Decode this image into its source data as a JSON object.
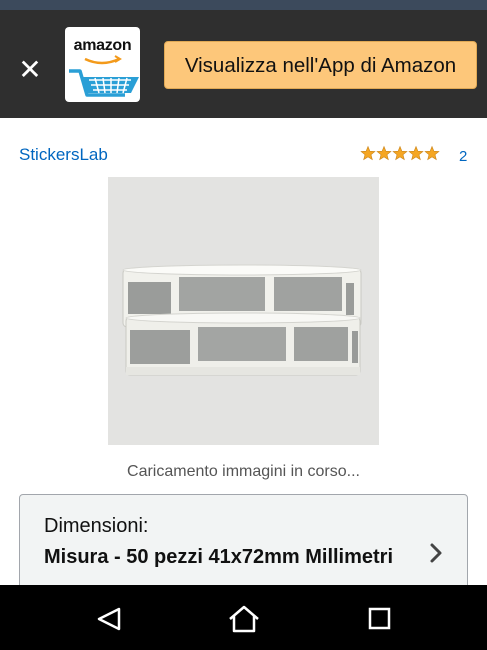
{
  "banner": {
    "close_icon": "close-icon",
    "app_logo_text": "amazon",
    "open_app_label": "Visualizza nell'App di Amazon"
  },
  "product": {
    "brand": "StickersLab",
    "rating_stars": 5,
    "rating_count": "2",
    "image_loading_text": "Caricamento immagini in corso..."
  },
  "variation": {
    "label": "Dimensioni:",
    "value": "Misura - 50 pezzi 41x72mm Millimetri"
  },
  "navbar": {
    "back_icon": "back-triangle-icon",
    "home_icon": "home-icon",
    "recents_icon": "recents-square-icon"
  },
  "colors": {
    "banner_bg": "#2f2f2f",
    "button_bg": "#fdc77a",
    "link": "#0066c0",
    "star": "#f5a623"
  }
}
